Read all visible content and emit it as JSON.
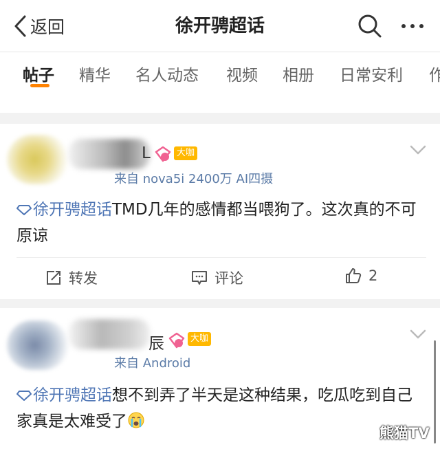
{
  "header": {
    "back_label": "返回",
    "title": "徐开骋超话"
  },
  "tabs": [
    "帖子",
    "精华",
    "名人动态",
    "视频",
    "相册",
    "日常安利",
    "作"
  ],
  "posts": [
    {
      "name_tail": "L",
      "badge": "大咖",
      "source": "来自 nova5i 2400万 AI四摄",
      "topic": "徐开骋超话",
      "text": "TMD几年的感情都当喂狗了。这次真的不可原谅",
      "actions": {
        "repost": "转发",
        "comment": "评论",
        "like_count": "2"
      }
    },
    {
      "name_tail": "辰",
      "badge": "大咖",
      "source": "来自 Android",
      "topic": "徐开骋超话",
      "text": "想不到弄了半天是这种结果，吃瓜吃到自己家真是太难受了"
    }
  ],
  "watermark": "熊猫TV",
  "colors": {
    "accent": "#ff8200",
    "topic": "#4f76b5",
    "badge": "#ffb800",
    "source": "#5b7ba7"
  }
}
